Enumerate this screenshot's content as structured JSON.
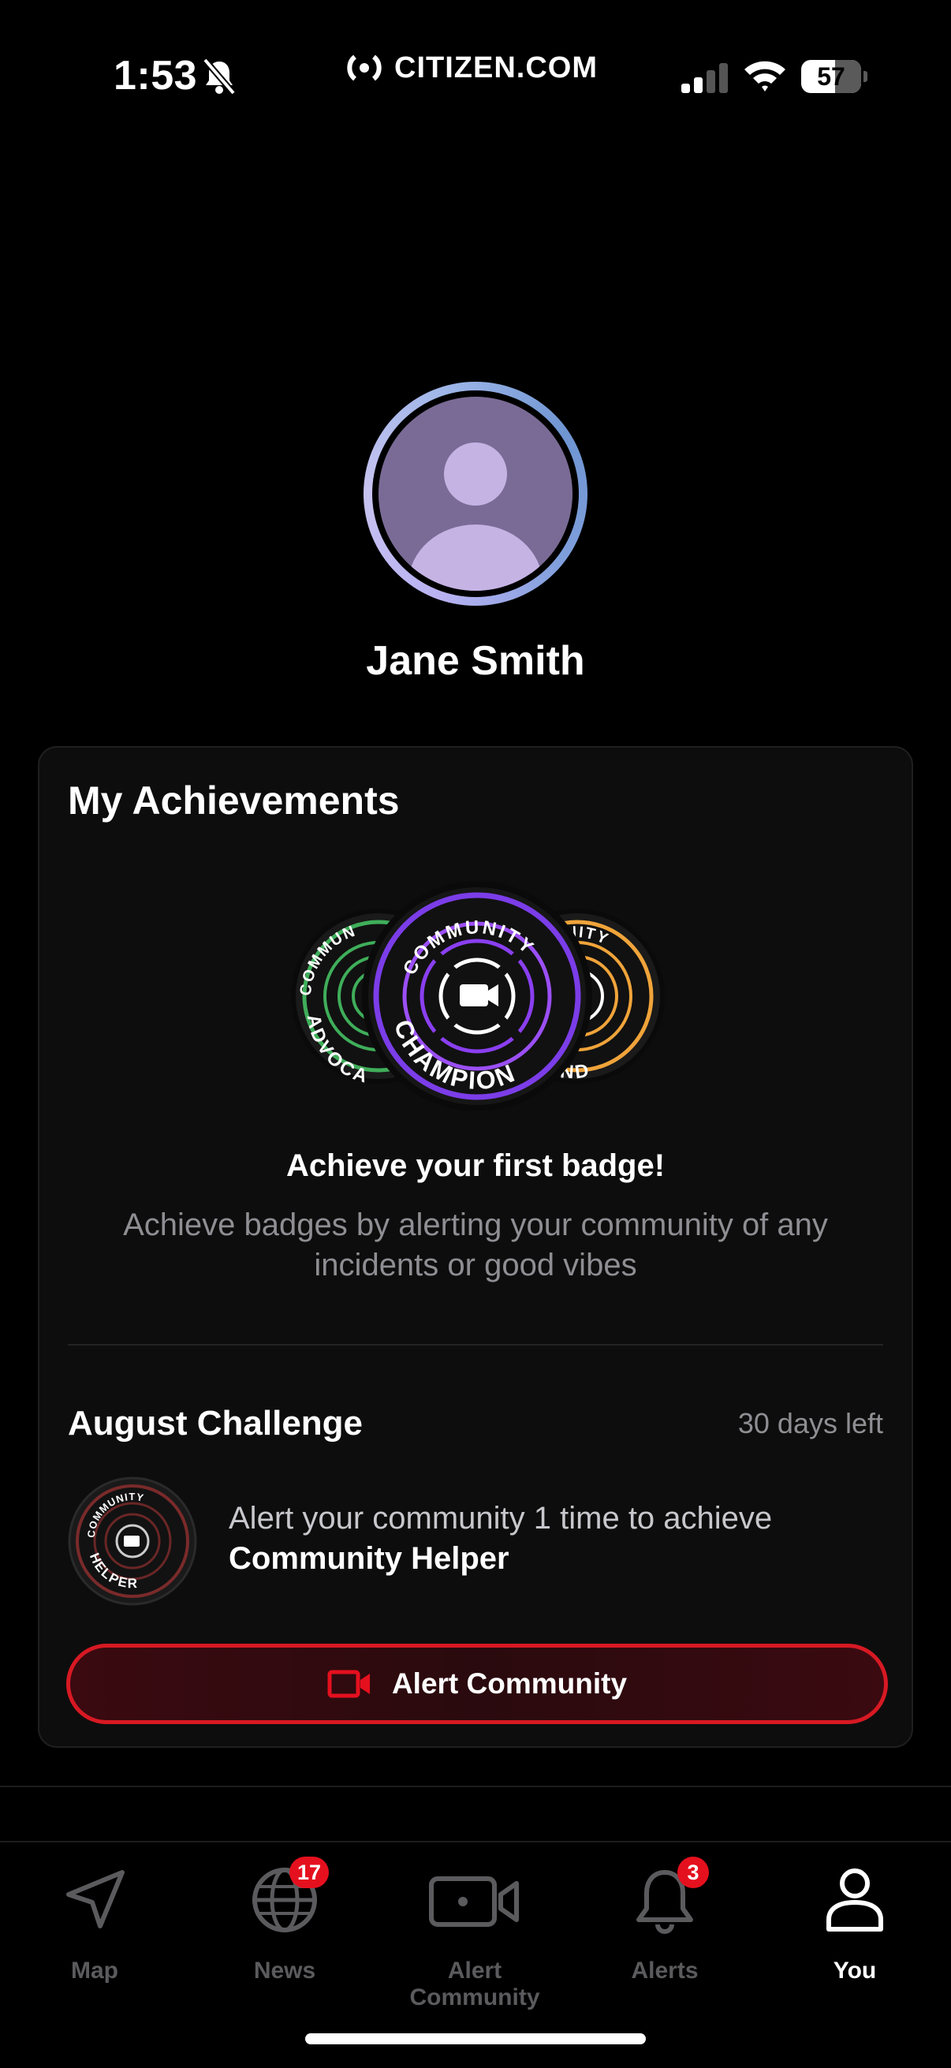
{
  "status_bar": {
    "time": "1:53",
    "brand": "CITIZEN.COM",
    "battery_level": "57",
    "icons": [
      "bell-slash-icon",
      "signal-icon",
      "wifi-icon",
      "battery-icon"
    ]
  },
  "profile": {
    "name": "Jane Smith",
    "avatar_icon": "person-placeholder-icon"
  },
  "achievements": {
    "title": "My Achievements",
    "badges": [
      {
        "top": "COMMUN",
        "bottom": "ADVOCA",
        "color": "#3fae5a"
      },
      {
        "top": "COMMUNITY",
        "bottom": "CHAMPION",
        "color": "#8a3ff0"
      },
      {
        "top": "MMUNITY",
        "bottom": "EGEND",
        "color": "#f0a43a"
      }
    ],
    "headline": "Achieve your first badge!",
    "description": "Achieve badges by alerting your community of any incidents or good vibes",
    "challenge": {
      "title": "August Challenge",
      "days_left": "30 days left",
      "badge_top": "COMMUNITY",
      "badge_bottom": "HELPER",
      "text": "Alert your community 1 time to achieve",
      "badge_name": "Community Helper"
    },
    "button_label": "Alert Community",
    "button_icon": "video-camera-icon"
  },
  "tabbar": {
    "tabs": [
      {
        "label": "Map",
        "icon": "navigation-arrow-icon",
        "badge": ""
      },
      {
        "label": "News",
        "icon": "globe-icon",
        "badge": "17"
      },
      {
        "label": "Alert Community",
        "icon": "video-camera-icon",
        "badge": ""
      },
      {
        "label": "Alerts",
        "icon": "bell-icon",
        "badge": "3"
      },
      {
        "label": "You",
        "icon": "person-icon",
        "badge": ""
      }
    ],
    "active": "You"
  },
  "colors": {
    "accent_red": "#d71923",
    "badge_red": "#e5101e",
    "card_bg": "#0d0d0d",
    "muted_text": "#8e8e93"
  }
}
